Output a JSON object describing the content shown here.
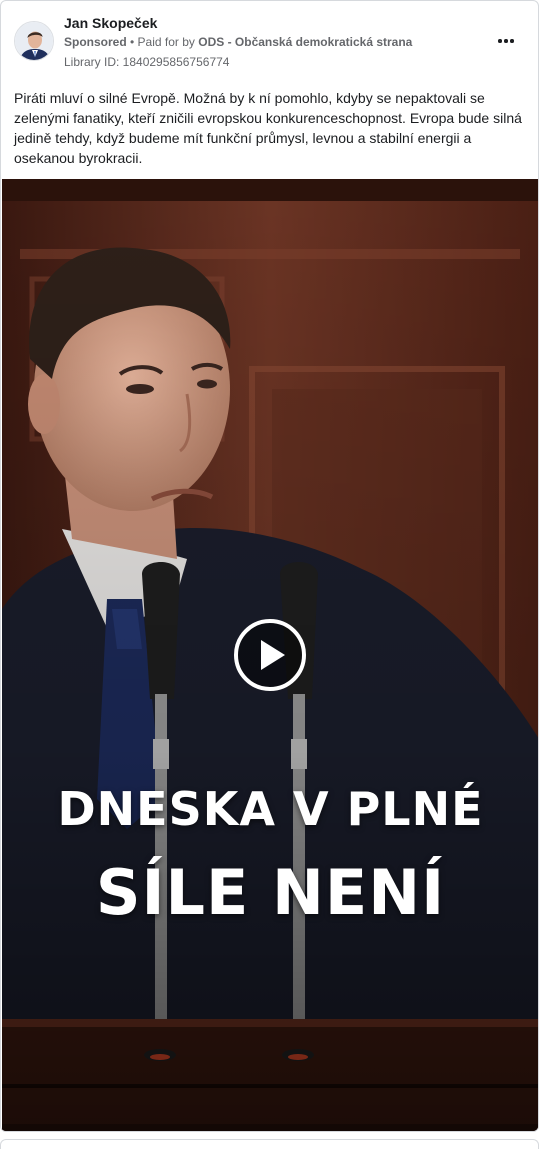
{
  "ad": {
    "page_name": "Jan Skopeček",
    "sponsored_label": "Sponsored",
    "separator": " • ",
    "paid_for_prefix": "Paid for by ",
    "payer": "ODS - Občanská demokratická strana",
    "library_id": "Library ID: 1840295856756774",
    "body_text": "Piráti mluví o silné Evropě. Možná by k ní pomohlo, kdyby se nepaktovali se zelenými fanatiky, kteří zničili evropskou konkurenceschopnost. Evropa bude silná jedině tehdy, když budeme mít funkční průmysl, levnou a stabilní energii a osekanou byrokracii."
  },
  "video": {
    "caption_line1": "DNESKA V PLNÉ",
    "caption_line2": "SÍLE NENÍ"
  },
  "icons": {
    "more": "more-options-icon",
    "play": "play-icon"
  }
}
